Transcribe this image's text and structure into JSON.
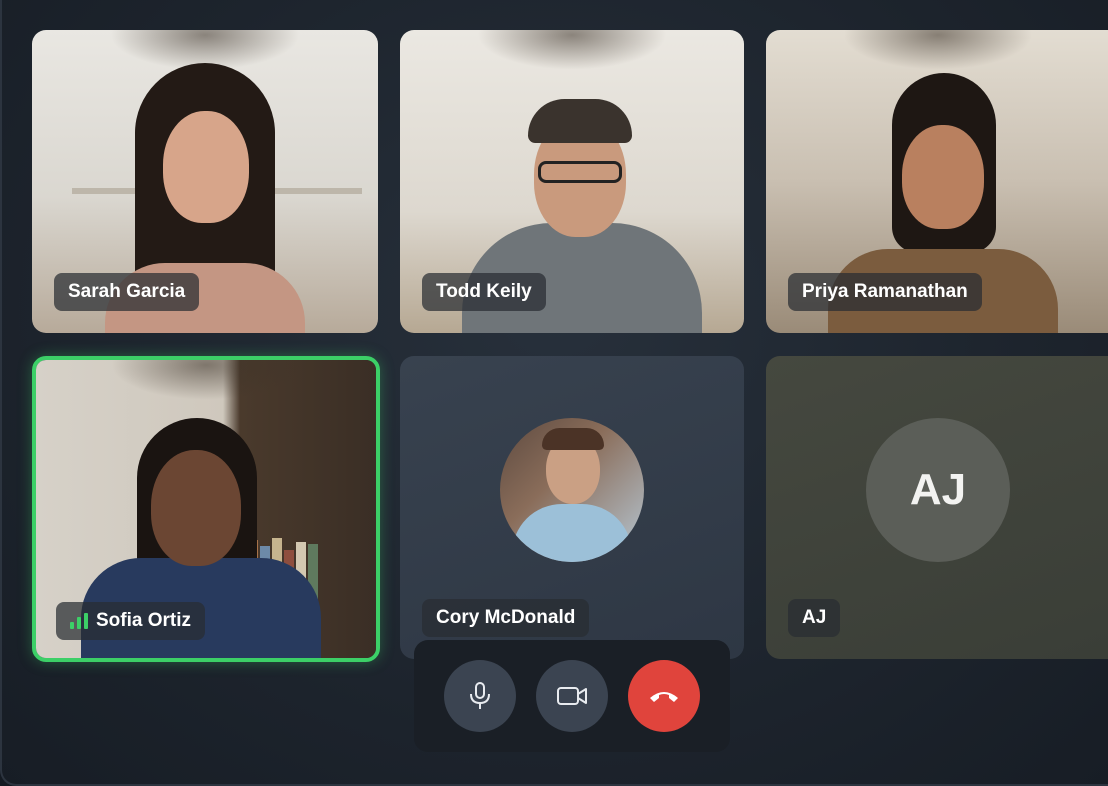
{
  "participants": [
    {
      "name": "Sarah Garcia",
      "video": true
    },
    {
      "name": "Todd Keily",
      "video": true
    },
    {
      "name": "Priya Ramanathan",
      "video": true
    },
    {
      "name": "Sofia Ortiz",
      "video": true,
      "speaking": true
    },
    {
      "name": "Cory McDonald",
      "video": false,
      "avatar": "photo"
    },
    {
      "name": "AJ",
      "video": false,
      "avatar_initials": "AJ"
    }
  ],
  "controls": {
    "mic_icon": "microphone-icon",
    "camera_icon": "video-camera-icon",
    "end_icon": "phone-hangup-icon"
  },
  "colors": {
    "active_speaker": "#3ccf67",
    "end_call": "#e0443c",
    "control_bg": "#3b4451"
  }
}
